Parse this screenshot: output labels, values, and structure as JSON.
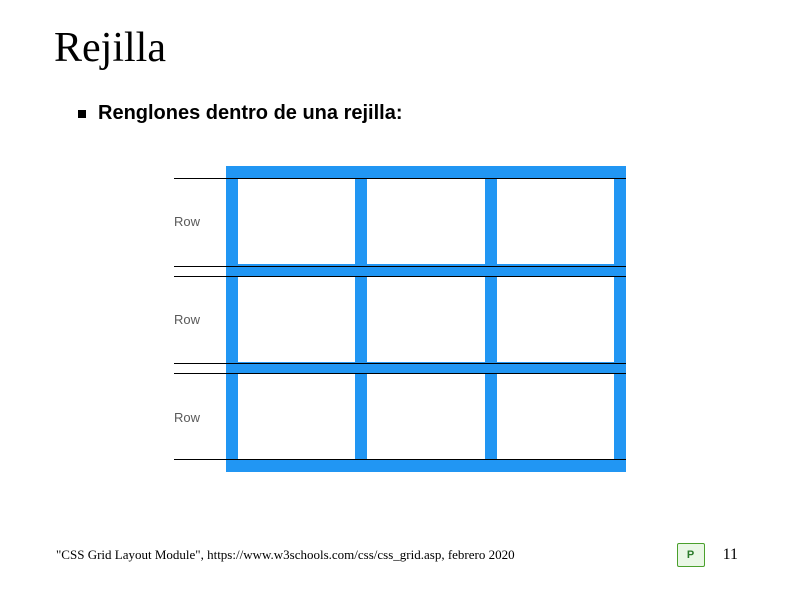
{
  "title": "Rejilla",
  "bullet": "Renglones dentro de una rejilla:",
  "grid": {
    "row_labels": [
      "Row",
      "Row",
      "Row"
    ],
    "columns": 3,
    "rows": 3
  },
  "citation": "\"CSS Grid Layout Module\", https://www.w3schools.com/css/css_grid.asp, febrero 2020",
  "logo_text": "P",
  "page_number": "11"
}
